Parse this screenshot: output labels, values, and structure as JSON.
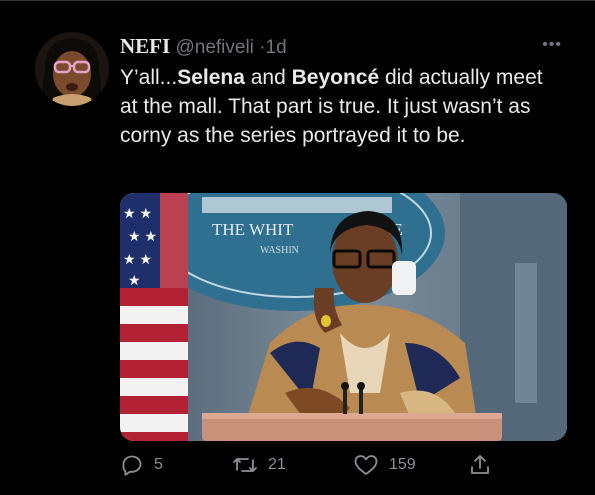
{
  "tweet": {
    "author_name": "NEFI",
    "handle": "@nefiveli",
    "separator": "·",
    "time": "1d",
    "more_label": "•••",
    "text": {
      "p1": "Y’all...",
      "b1": "Selena",
      "p2": " and ",
      "b2": "Beyoncé",
      "p3": " did actually meet at the mall. That part is true. It just wasn’t as corny as the series portrayed it to be."
    },
    "media": {
      "seal_text": "THE WHIT",
      "seal_text_right": "SE",
      "seal_subtext": "WASHIN"
    },
    "actions": {
      "replies": "5",
      "retweets": "21",
      "likes": "159"
    }
  },
  "colors": {
    "background": "#000000",
    "text": "#e7e9ea",
    "muted": "#71767b"
  }
}
